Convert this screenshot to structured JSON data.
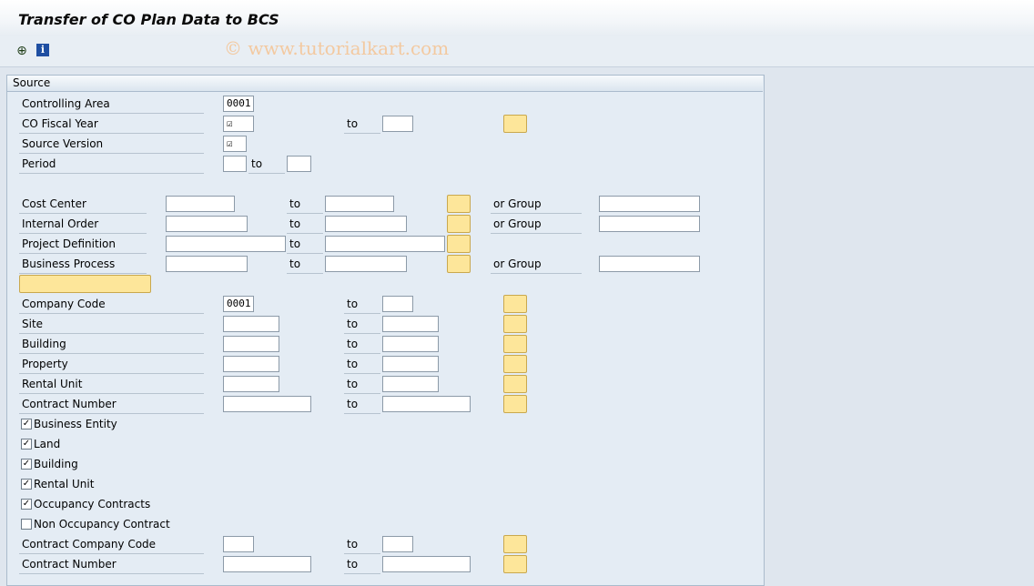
{
  "window": {
    "title": "Transfer of CO Plan Data to BCS"
  },
  "toolbar": {
    "execute_icon": "execute-icon",
    "info_icon": "information-icon",
    "info_glyph": "i",
    "execute_glyph": "⊕"
  },
  "watermark": "© www.tutorialkart.com",
  "source": {
    "header": "Source",
    "to_label": "to",
    "or_group_label": "or Group",
    "controlling_area": {
      "label": "Controlling Area",
      "value": "0001"
    },
    "co_fiscal_year": {
      "label": "CO Fiscal Year",
      "value": "☑"
    },
    "source_version": {
      "label": "Source Version",
      "value": "☑"
    },
    "period": {
      "label": "Period"
    },
    "cost_center": {
      "label": "Cost Center"
    },
    "internal_order": {
      "label": "Internal Order"
    },
    "project_definition": {
      "label": "Project Definition"
    },
    "business_process": {
      "label": "Business Process"
    },
    "company_code": {
      "label": "Company Code",
      "value": "0001"
    },
    "site": {
      "label": "Site"
    },
    "building": {
      "label": "Building"
    },
    "property": {
      "label": "Property"
    },
    "rental_unit": {
      "label": "Rental Unit"
    },
    "contract_number": {
      "label": "Contract Number"
    },
    "checkboxes": [
      {
        "label": "Business Entity",
        "checked": "✓"
      },
      {
        "label": "Land",
        "checked": "✓"
      },
      {
        "label": "Building",
        "checked": "✓"
      },
      {
        "label": "Rental Unit",
        "checked": "✓"
      },
      {
        "label": "Occupancy Contracts",
        "checked": "✓"
      },
      {
        "label": "Non Occupancy Contract",
        "checked": ""
      }
    ],
    "contract_company_code": {
      "label": "Contract Company Code"
    },
    "contract_number_2": {
      "label": "Contract Number"
    }
  },
  "colors": {
    "background": "#dfe6ee",
    "input_bg": "#ffffff",
    "button_yellow": "#fde69a",
    "watermark": "#f3c9a0"
  }
}
